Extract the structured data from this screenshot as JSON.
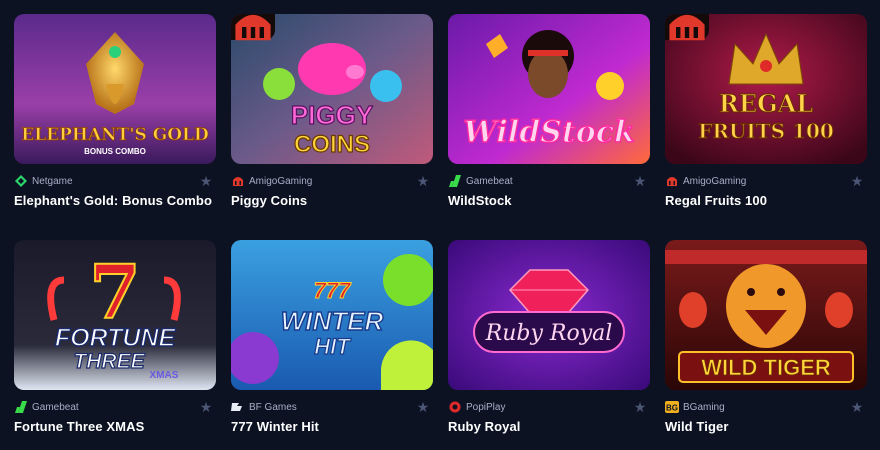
{
  "games": [
    {
      "title": "Elephant's Gold: Bonus Combo",
      "provider": "Netgame",
      "provider_icon": "netgame-icon",
      "art_text": "ELEPHANT'S GOLD",
      "art_sub": "BONUS COMBO",
      "badge": false
    },
    {
      "title": "Piggy Coins",
      "provider": "AmigoGaming",
      "provider_icon": "amigo-icon",
      "art_text": "PIGGY",
      "art_sub": "COINS",
      "badge": true
    },
    {
      "title": "WildStock",
      "provider": "Gamebeat",
      "provider_icon": "gamebeat-icon",
      "art_text": "WildStock",
      "art_sub": "",
      "badge": false
    },
    {
      "title": "Regal Fruits 100",
      "provider": "AmigoGaming",
      "provider_icon": "amigo-icon",
      "art_text": "REGAL",
      "art_sub": "FRUITS 100",
      "badge": true
    },
    {
      "title": "Fortune Three XMAS",
      "provider": "Gamebeat",
      "provider_icon": "gamebeat-icon",
      "art_text": "FORTUNE",
      "art_sub": "THREE",
      "art_sub2": "XMAS",
      "badge": false
    },
    {
      "title": "777 Winter Hit",
      "provider": "BF Games",
      "provider_icon": "bfgames-icon",
      "art_text": "WINTER",
      "art_sub": "HIT",
      "art_num": "777",
      "badge": false
    },
    {
      "title": "Ruby Royal",
      "provider": "PopiPlay",
      "provider_icon": "popiplay-icon",
      "art_text": "Ruby Royal",
      "art_sub": "",
      "badge": false
    },
    {
      "title": "Wild Tiger",
      "provider": "BGaming",
      "provider_icon": "bgaming-icon",
      "art_text": "WILD TIGER",
      "art_sub": "",
      "badge": false
    }
  ],
  "favorite_icon": "star-icon"
}
